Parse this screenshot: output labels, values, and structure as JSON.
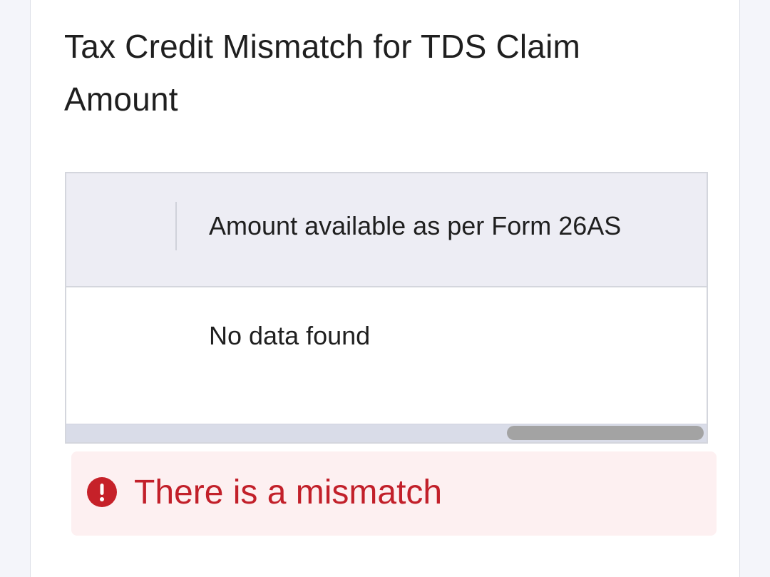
{
  "section": {
    "title": "Tax Credit Mismatch for TDS Claim Amount"
  },
  "table": {
    "columns": [
      "",
      "Amount available as per Form 26AS"
    ],
    "empty_message": "No data found"
  },
  "alert": {
    "icon": "exclamation-circle-icon",
    "message": "There is a mismatch",
    "color": "#c2202a",
    "background": "#fdf0f1"
  }
}
